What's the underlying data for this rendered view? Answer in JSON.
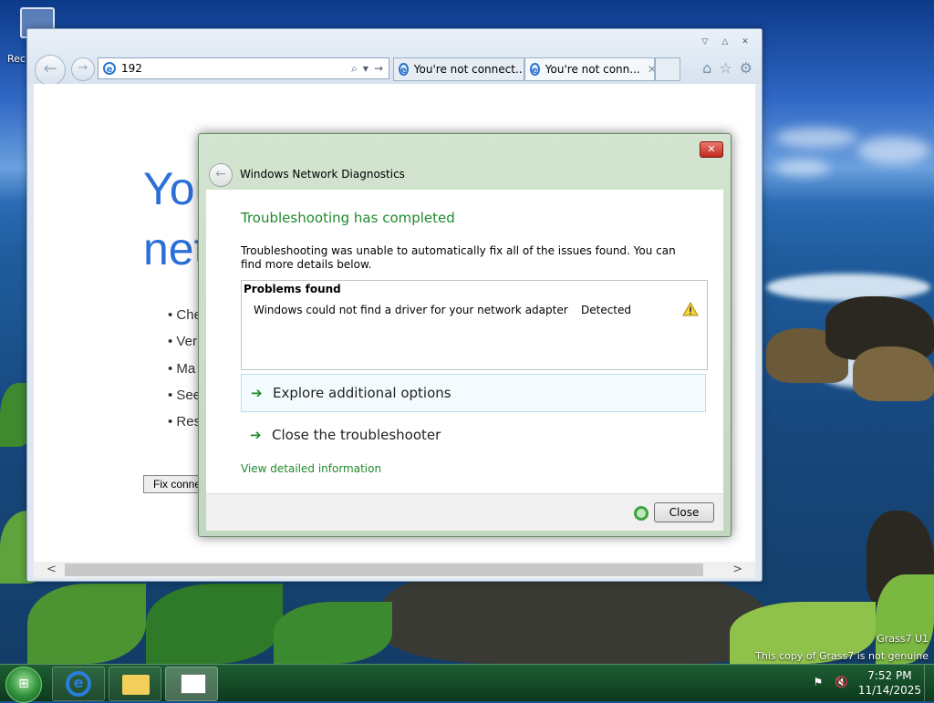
{
  "desktop": {
    "icon_label": "Rec",
    "watermark_line1": "Grass7 U1",
    "watermark_line2": "This copy of Grass7 is not genuine"
  },
  "browser": {
    "address": "192",
    "tabs": [
      {
        "label": "You're not connect..."
      },
      {
        "label": "You're not conn..."
      }
    ],
    "page_heading_1": "You",
    "page_heading_2": "net",
    "page_bullets": [
      "Che",
      "Ver",
      "Ma",
      "See",
      "Res"
    ],
    "page_fix_button": "Fix conne"
  },
  "dialog": {
    "title": "Windows Network Diagnostics",
    "heading": "Troubleshooting has completed",
    "description": "Troubleshooting was unable to automatically fix all of the issues found. You can find more details below.",
    "problems_header": "Problems found",
    "problems": [
      {
        "text": "Windows could not find a driver for your network adapter",
        "status": "Detected",
        "icon": "warning-icon"
      }
    ],
    "options": [
      {
        "label": "Explore additional options"
      },
      {
        "label": "Close the troubleshooter"
      }
    ],
    "detail_link": "View detailed information",
    "close_button": "Close"
  },
  "taskbar": {
    "time": "7:52 PM",
    "date": "11/14/2025"
  },
  "colors": {
    "accent_green": "#1f8a2c",
    "ie_blue": "#2b6fd8",
    "close_red": "#c0291c"
  }
}
